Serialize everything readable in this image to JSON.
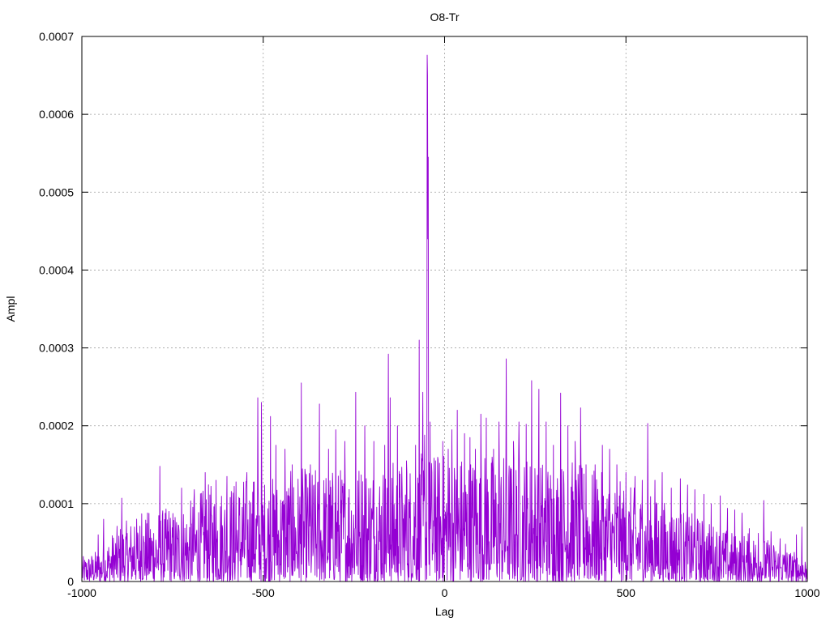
{
  "chart_data": {
    "type": "line",
    "title": "O8-Tr",
    "xlabel": "Lag",
    "ylabel": "Ampl",
    "xlim": [
      -1000,
      1000
    ],
    "ylim": [
      0,
      0.0007
    ],
    "grid": true,
    "x_ticks": [
      -1000,
      -500,
      0,
      500,
      1000
    ],
    "x_tick_labels": [
      "-1000",
      "-500",
      "0",
      "500",
      "1000"
    ],
    "y_ticks": [
      0,
      0.0001,
      0.0002,
      0.0003,
      0.0004,
      0.0005,
      0.0006,
      0.0007
    ],
    "y_tick_labels": [
      "0",
      "0.0001",
      "0.0002",
      "0.0003",
      "0.0004",
      "0.0005",
      "0.0006",
      "0.0007"
    ],
    "series_color": "#9400d3",
    "x_start": -1000,
    "x_end": 1000,
    "envelope_points": [
      [
        -1000,
        3e-05
      ],
      [
        -950,
        4e-05
      ],
      [
        -900,
        7e-05
      ],
      [
        -850,
        8e-05
      ],
      [
        -800,
        9e-05
      ],
      [
        -750,
        9e-05
      ],
      [
        -700,
        0.0001
      ],
      [
        -650,
        0.00012
      ],
      [
        -600,
        0.00012
      ],
      [
        -550,
        0.00013
      ],
      [
        -500,
        0.00013
      ],
      [
        -450,
        0.00013
      ],
      [
        -400,
        0.00014
      ],
      [
        -350,
        0.00014
      ],
      [
        -300,
        0.00014
      ],
      [
        -250,
        0.00015
      ],
      [
        -200,
        0.00015
      ],
      [
        -150,
        0.00015
      ],
      [
        -100,
        0.00015
      ],
      [
        -50,
        0.00016
      ],
      [
        0,
        0.00016
      ],
      [
        50,
        0.00016
      ],
      [
        100,
        0.00016
      ],
      [
        150,
        0.00016
      ],
      [
        200,
        0.00016
      ],
      [
        250,
        0.00016
      ],
      [
        300,
        0.00015
      ],
      [
        350,
        0.00015
      ],
      [
        400,
        0.00014
      ],
      [
        450,
        0.00013
      ],
      [
        500,
        0.00012
      ],
      [
        550,
        0.00011
      ],
      [
        600,
        0.0001
      ],
      [
        650,
        9e-05
      ],
      [
        700,
        8e-05
      ],
      [
        750,
        7e-05
      ],
      [
        800,
        6e-05
      ],
      [
        850,
        6e-05
      ],
      [
        900,
        5e-05
      ],
      [
        950,
        4e-05
      ],
      [
        1000,
        3e-05
      ]
    ],
    "peaks": [
      [
        -1000,
        3e-05
      ],
      [
        -955,
        6e-05
      ],
      [
        -940,
        8e-05
      ],
      [
        -890,
        0.000107
      ],
      [
        -855,
        7e-05
      ],
      [
        -835,
        8.7e-05
      ],
      [
        -785,
        0.000148
      ],
      [
        -760,
        9e-05
      ],
      [
        -725,
        0.00012
      ],
      [
        -690,
        0.000118
      ],
      [
        -660,
        0.00014
      ],
      [
        -630,
        0.00013
      ],
      [
        -600,
        0.000135
      ],
      [
        -575,
        0.000128
      ],
      [
        -545,
        0.00014
      ],
      [
        -525,
        0.000128
      ],
      [
        -515,
        0.000236
      ],
      [
        -505,
        0.00023
      ],
      [
        -480,
        0.000212
      ],
      [
        -465,
        0.000175
      ],
      [
        -440,
        0.00017
      ],
      [
        -420,
        0.00015
      ],
      [
        -395,
        0.000255
      ],
      [
        -370,
        0.00015
      ],
      [
        -345,
        0.000228
      ],
      [
        -320,
        0.00017
      ],
      [
        -300,
        0.000195
      ],
      [
        -275,
        0.00018
      ],
      [
        -245,
        0.000243
      ],
      [
        -220,
        0.0002
      ],
      [
        -195,
        0.00018
      ],
      [
        -165,
        0.000175
      ],
      [
        -155,
        0.000292
      ],
      [
        -150,
        0.000236
      ],
      [
        -130,
        0.0002
      ],
      [
        -105,
        0.000155
      ],
      [
        -80,
        0.000175
      ],
      [
        -70,
        0.00031
      ],
      [
        -60,
        0.000243
      ],
      [
        -55,
        0.000188
      ],
      [
        -48,
        0.000676
      ],
      [
        -47,
        0.00065
      ],
      [
        -46,
        0.00044
      ],
      [
        -45,
        0.000545
      ],
      [
        -40,
        0.000205
      ],
      [
        -25,
        0.000155
      ],
      [
        -5,
        0.00018
      ],
      [
        10,
        0.00017
      ],
      [
        20,
        0.000195
      ],
      [
        35,
        0.00022
      ],
      [
        55,
        0.00019
      ],
      [
        70,
        0.000185
      ],
      [
        85,
        0.00017
      ],
      [
        100,
        0.000215
      ],
      [
        115,
        0.00021
      ],
      [
        135,
        0.00017
      ],
      [
        150,
        0.000205
      ],
      [
        170,
        0.000286
      ],
      [
        190,
        0.00018
      ],
      [
        205,
        0.000205
      ],
      [
        225,
        0.000202
      ],
      [
        240,
        0.000258
      ],
      [
        260,
        0.000247
      ],
      [
        280,
        0.000205
      ],
      [
        300,
        0.000175
      ],
      [
        320,
        0.000242
      ],
      [
        340,
        0.0002
      ],
      [
        360,
        0.00018
      ],
      [
        375,
        0.000223
      ],
      [
        390,
        0.00015
      ],
      [
        415,
        0.00015
      ],
      [
        435,
        0.000175
      ],
      [
        455,
        0.00017
      ],
      [
        475,
        0.00015
      ],
      [
        500,
        0.00014
      ],
      [
        525,
        0.000135
      ],
      [
        545,
        0.00013
      ],
      [
        560,
        0.000203
      ],
      [
        580,
        0.00013
      ],
      [
        600,
        0.00014
      ],
      [
        625,
        0.00012
      ],
      [
        650,
        0.000132
      ],
      [
        670,
        0.000124
      ],
      [
        690,
        0.000118
      ],
      [
        715,
        0.000112
      ],
      [
        735,
        0.0001
      ],
      [
        760,
        0.00011
      ],
      [
        780,
        9.4e-05
      ],
      [
        800,
        9.2e-05
      ],
      [
        820,
        8.8e-05
      ],
      [
        840,
        6.8e-05
      ],
      [
        865,
        6.2e-05
      ],
      [
        880,
        0.000104
      ],
      [
        900,
        6.4e-05
      ],
      [
        925,
        5.5e-05
      ],
      [
        940,
        4.8e-05
      ],
      [
        970,
        6e-05
      ],
      [
        985,
        7e-05
      ],
      [
        1000,
        2.8e-05
      ]
    ]
  }
}
